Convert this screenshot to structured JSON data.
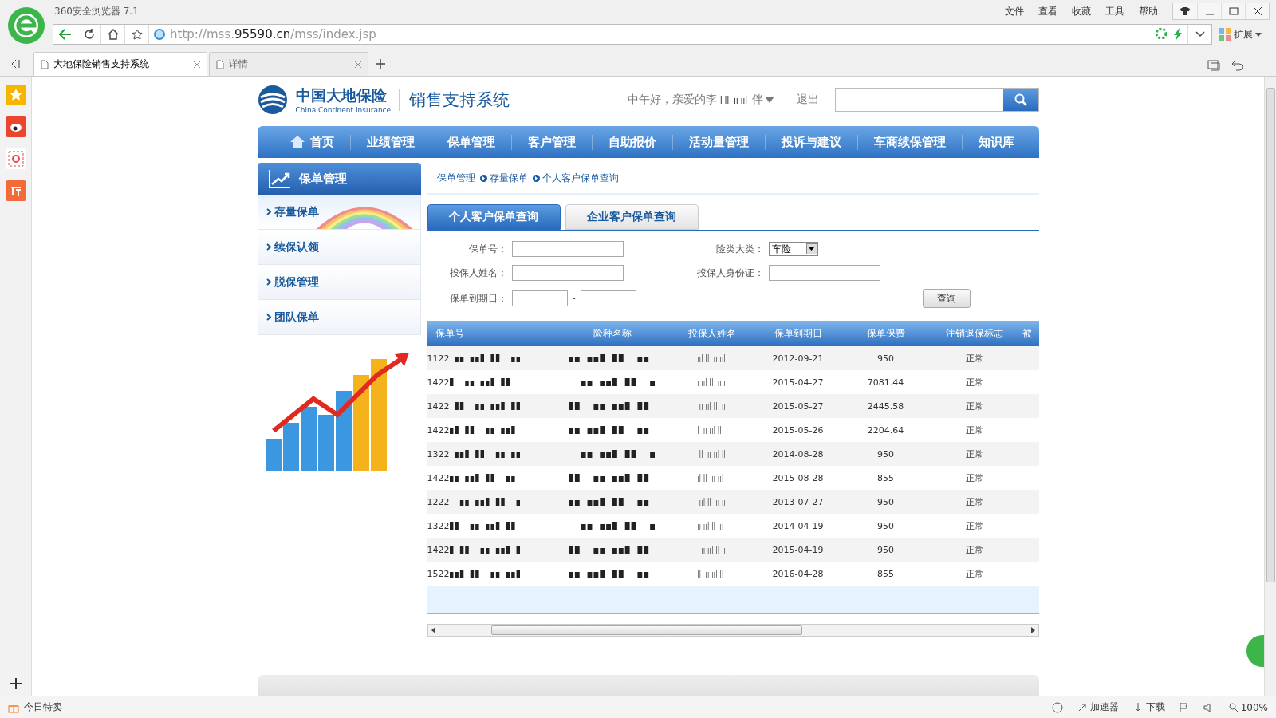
{
  "browser": {
    "title": "360安全浏览器 7.1",
    "menu": [
      "文件",
      "查看",
      "收藏",
      "工具",
      "帮助"
    ],
    "address": {
      "prefix": "http://mss.",
      "domain": "95590.cn",
      "path": "/mss/index.jsp"
    },
    "extension_label": "扩展",
    "tabs": [
      {
        "label": "大地保险销售支持系统",
        "selected": true
      },
      {
        "label": "详情",
        "selected": false
      }
    ]
  },
  "header": {
    "logo_cn": "中国大地保险",
    "logo_en": "China Continent Insurance",
    "system_name": "销售支持系统",
    "greeting": "中午好，亲爱的李",
    "greeting_end": "伴",
    "logout": "退出"
  },
  "nav": [
    {
      "label": "首页"
    },
    {
      "label": "业绩管理"
    },
    {
      "label": "保单管理"
    },
    {
      "label": "客户管理"
    },
    {
      "label": "自助报价"
    },
    {
      "label": "活动量管理"
    },
    {
      "label": "投诉与建议"
    },
    {
      "label": "车商续保管理"
    },
    {
      "label": "知识库"
    }
  ],
  "sidebar": {
    "title": "保单管理",
    "items": [
      {
        "label": "存量保单",
        "selected": true
      },
      {
        "label": "续保认领",
        "selected": false
      },
      {
        "label": "脱保管理",
        "selected": false
      },
      {
        "label": "团队保单",
        "selected": false
      }
    ]
  },
  "breadcrumb": [
    "保单管理",
    "存量保单",
    "个人客户保单查询"
  ],
  "query_tabs": [
    {
      "label": "个人客户保单查询",
      "selected": true
    },
    {
      "label": "企业客户保单查询",
      "selected": false
    }
  ],
  "form": {
    "fields": [
      {
        "label": "保单号：",
        "kind": "text"
      },
      {
        "label": "险类大类：",
        "kind": "select",
        "value": "车险"
      },
      {
        "label": "投保人姓名：",
        "kind": "text"
      },
      {
        "label": "投保人身份证：",
        "kind": "text"
      },
      {
        "label": "保单到期日：",
        "kind": "range",
        "separator": "-"
      }
    ],
    "button": "查询"
  },
  "table": {
    "columns": [
      "保单号",
      "险种名称",
      "投保人姓名",
      "保单到期日",
      "保单保费",
      "注销退保标志",
      "被"
    ],
    "rows": [
      {
        "policy_prefix": "1122",
        "due": "2012-09-21",
        "premium": "950",
        "status": "正常"
      },
      {
        "policy_prefix": "1422",
        "due": "2015-04-27",
        "premium": "7081.44",
        "status": "正常"
      },
      {
        "policy_prefix": "1422",
        "due": "2015-05-27",
        "premium": "2445.58",
        "status": "正常"
      },
      {
        "policy_prefix": "1422",
        "due": "2015-05-26",
        "premium": "2204.64",
        "status": "正常"
      },
      {
        "policy_prefix": "1322",
        "due": "2014-08-28",
        "premium": "950",
        "status": "正常"
      },
      {
        "policy_prefix": "1422",
        "due": "2015-08-28",
        "premium": "855",
        "status": "正常"
      },
      {
        "policy_prefix": "1222",
        "due": "2013-07-27",
        "premium": "950",
        "status": "正常"
      },
      {
        "policy_prefix": "1322",
        "due": "2014-04-19",
        "premium": "950",
        "status": "正常"
      },
      {
        "policy_prefix": "1422",
        "due": "2015-04-19",
        "premium": "950",
        "status": "正常"
      },
      {
        "policy_prefix": "1522",
        "due": "2016-04-28",
        "premium": "855",
        "status": "正常"
      }
    ]
  },
  "status_bar": {
    "left": "今日特卖",
    "items": [
      "加速器",
      "下载"
    ],
    "zoom": "100%"
  }
}
